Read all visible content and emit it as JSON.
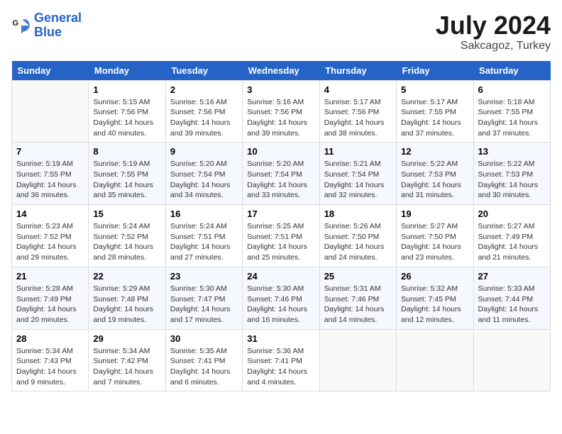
{
  "logo": {
    "line1": "General",
    "line2": "Blue"
  },
  "title": "July 2024",
  "location": "Sakcagoz, Turkey",
  "days_header": [
    "Sunday",
    "Monday",
    "Tuesday",
    "Wednesday",
    "Thursday",
    "Friday",
    "Saturday"
  ],
  "weeks": [
    [
      {
        "day": "",
        "info": ""
      },
      {
        "day": "1",
        "info": "Sunrise: 5:15 AM\nSunset: 7:56 PM\nDaylight: 14 hours\nand 40 minutes."
      },
      {
        "day": "2",
        "info": "Sunrise: 5:16 AM\nSunset: 7:56 PM\nDaylight: 14 hours\nand 39 minutes."
      },
      {
        "day": "3",
        "info": "Sunrise: 5:16 AM\nSunset: 7:56 PM\nDaylight: 14 hours\nand 39 minutes."
      },
      {
        "day": "4",
        "info": "Sunrise: 5:17 AM\nSunset: 7:56 PM\nDaylight: 14 hours\nand 38 minutes."
      },
      {
        "day": "5",
        "info": "Sunrise: 5:17 AM\nSunset: 7:55 PM\nDaylight: 14 hours\nand 37 minutes."
      },
      {
        "day": "6",
        "info": "Sunrise: 5:18 AM\nSunset: 7:55 PM\nDaylight: 14 hours\nand 37 minutes."
      }
    ],
    [
      {
        "day": "7",
        "info": "Sunrise: 5:19 AM\nSunset: 7:55 PM\nDaylight: 14 hours\nand 36 minutes."
      },
      {
        "day": "8",
        "info": "Sunrise: 5:19 AM\nSunset: 7:55 PM\nDaylight: 14 hours\nand 35 minutes."
      },
      {
        "day": "9",
        "info": "Sunrise: 5:20 AM\nSunset: 7:54 PM\nDaylight: 14 hours\nand 34 minutes."
      },
      {
        "day": "10",
        "info": "Sunrise: 5:20 AM\nSunset: 7:54 PM\nDaylight: 14 hours\nand 33 minutes."
      },
      {
        "day": "11",
        "info": "Sunrise: 5:21 AM\nSunset: 7:54 PM\nDaylight: 14 hours\nand 32 minutes."
      },
      {
        "day": "12",
        "info": "Sunrise: 5:22 AM\nSunset: 7:53 PM\nDaylight: 14 hours\nand 31 minutes."
      },
      {
        "day": "13",
        "info": "Sunrise: 5:22 AM\nSunset: 7:53 PM\nDaylight: 14 hours\nand 30 minutes."
      }
    ],
    [
      {
        "day": "14",
        "info": "Sunrise: 5:23 AM\nSunset: 7:52 PM\nDaylight: 14 hours\nand 29 minutes."
      },
      {
        "day": "15",
        "info": "Sunrise: 5:24 AM\nSunset: 7:52 PM\nDaylight: 14 hours\nand 28 minutes."
      },
      {
        "day": "16",
        "info": "Sunrise: 5:24 AM\nSunset: 7:51 PM\nDaylight: 14 hours\nand 27 minutes."
      },
      {
        "day": "17",
        "info": "Sunrise: 5:25 AM\nSunset: 7:51 PM\nDaylight: 14 hours\nand 25 minutes."
      },
      {
        "day": "18",
        "info": "Sunrise: 5:26 AM\nSunset: 7:50 PM\nDaylight: 14 hours\nand 24 minutes."
      },
      {
        "day": "19",
        "info": "Sunrise: 5:27 AM\nSunset: 7:50 PM\nDaylight: 14 hours\nand 23 minutes."
      },
      {
        "day": "20",
        "info": "Sunrise: 5:27 AM\nSunset: 7:49 PM\nDaylight: 14 hours\nand 21 minutes."
      }
    ],
    [
      {
        "day": "21",
        "info": "Sunrise: 5:28 AM\nSunset: 7:49 PM\nDaylight: 14 hours\nand 20 minutes."
      },
      {
        "day": "22",
        "info": "Sunrise: 5:29 AM\nSunset: 7:48 PM\nDaylight: 14 hours\nand 19 minutes."
      },
      {
        "day": "23",
        "info": "Sunrise: 5:30 AM\nSunset: 7:47 PM\nDaylight: 14 hours\nand 17 minutes."
      },
      {
        "day": "24",
        "info": "Sunrise: 5:30 AM\nSunset: 7:46 PM\nDaylight: 14 hours\nand 16 minutes."
      },
      {
        "day": "25",
        "info": "Sunrise: 5:31 AM\nSunset: 7:46 PM\nDaylight: 14 hours\nand 14 minutes."
      },
      {
        "day": "26",
        "info": "Sunrise: 5:32 AM\nSunset: 7:45 PM\nDaylight: 14 hours\nand 12 minutes."
      },
      {
        "day": "27",
        "info": "Sunrise: 5:33 AM\nSunset: 7:44 PM\nDaylight: 14 hours\nand 11 minutes."
      }
    ],
    [
      {
        "day": "28",
        "info": "Sunrise: 5:34 AM\nSunset: 7:43 PM\nDaylight: 14 hours\nand 9 minutes."
      },
      {
        "day": "29",
        "info": "Sunrise: 5:34 AM\nSunset: 7:42 PM\nDaylight: 14 hours\nand 7 minutes."
      },
      {
        "day": "30",
        "info": "Sunrise: 5:35 AM\nSunset: 7:41 PM\nDaylight: 14 hours\nand 6 minutes."
      },
      {
        "day": "31",
        "info": "Sunrise: 5:36 AM\nSunset: 7:41 PM\nDaylight: 14 hours\nand 4 minutes."
      },
      {
        "day": "",
        "info": ""
      },
      {
        "day": "",
        "info": ""
      },
      {
        "day": "",
        "info": ""
      }
    ]
  ]
}
